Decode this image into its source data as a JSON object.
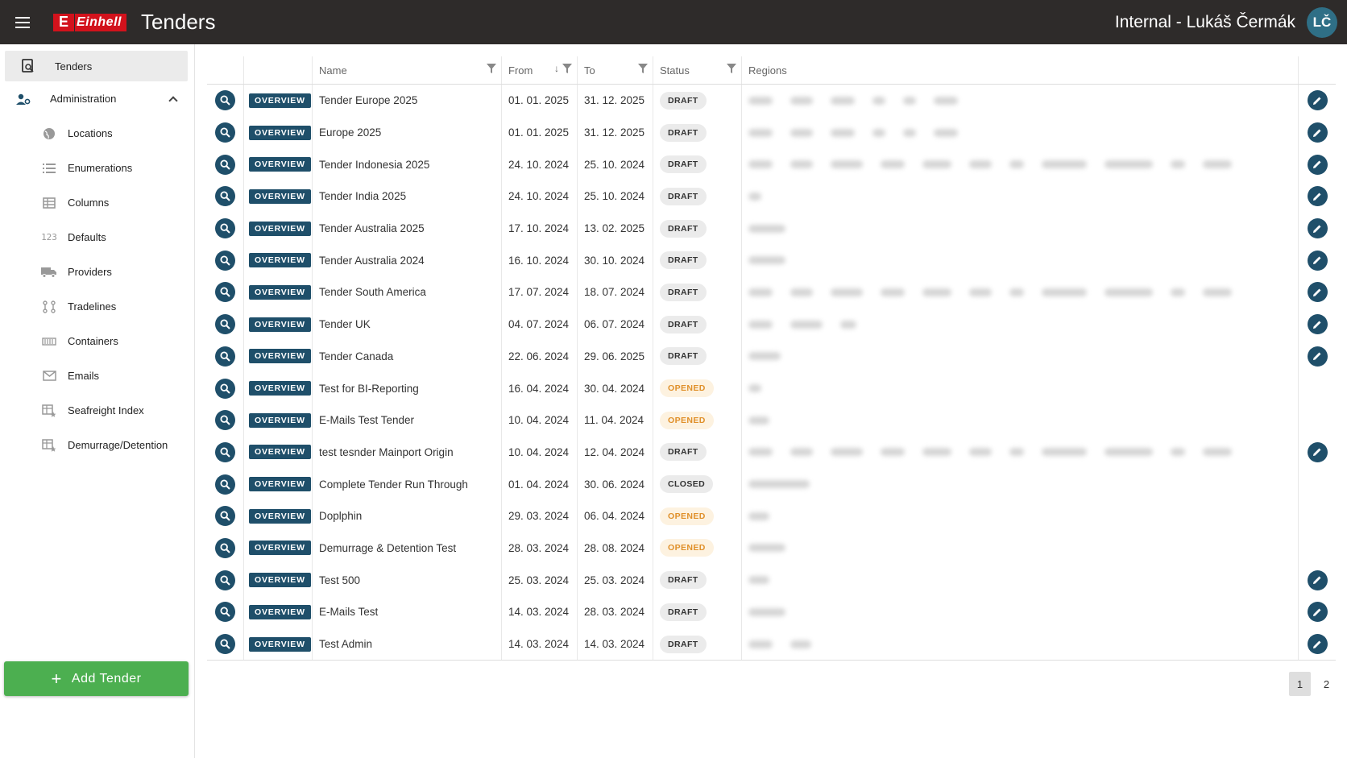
{
  "header": {
    "logo_letter": "E",
    "logo_text": "Einhell",
    "title": "Tenders",
    "user_name": "Internal - Lukáš Čermák",
    "avatar_initials": "LČ"
  },
  "sidebar": {
    "items": [
      {
        "label": "Tenders",
        "icon": "tenders-icon",
        "active": true
      },
      {
        "label": "Administration",
        "icon": "admin-users-icon",
        "expanded": true
      },
      {
        "label": "Locations",
        "icon": "globe-icon"
      },
      {
        "label": "Enumerations",
        "icon": "list-icon"
      },
      {
        "label": "Columns",
        "icon": "table-columns-icon"
      },
      {
        "label": "Defaults",
        "icon": "numbers-icon",
        "icon_text": "123"
      },
      {
        "label": "Providers",
        "icon": "truck-icon"
      },
      {
        "label": "Tradelines",
        "icon": "route-icon"
      },
      {
        "label": "Containers",
        "icon": "container-icon"
      },
      {
        "label": "Emails",
        "icon": "mail-icon"
      },
      {
        "label": "Seafreight Index",
        "icon": "table-star-icon"
      },
      {
        "label": "Demurrage/Detention",
        "icon": "table-star-icon"
      }
    ],
    "add_button": "Add Tender"
  },
  "table": {
    "columns": {
      "name": "Name",
      "from": "From",
      "to": "To",
      "status": "Status",
      "regions": "Regions"
    },
    "overview_label": "OVERVIEW",
    "rows": [
      {
        "name": "Tender Europe 2025",
        "from": "01. 01. 2025",
        "to": "31. 12. 2025",
        "status": "DRAFT",
        "editable": true
      },
      {
        "name": "Europe 2025",
        "from": "01. 01. 2025",
        "to": "31. 12. 2025",
        "status": "DRAFT",
        "editable": true
      },
      {
        "name": "Tender Indonesia 2025",
        "from": "24. 10. 2024",
        "to": "25. 10. 2024",
        "status": "DRAFT",
        "editable": true
      },
      {
        "name": "Tender India 2025",
        "from": "24. 10. 2024",
        "to": "25. 10. 2024",
        "status": "DRAFT",
        "editable": true
      },
      {
        "name": "Tender Australia 2025",
        "from": "17. 10. 2024",
        "to": "13. 02. 2025",
        "status": "DRAFT",
        "editable": true
      },
      {
        "name": "Tender Australia 2024",
        "from": "16. 10. 2024",
        "to": "30. 10. 2024",
        "status": "DRAFT",
        "editable": true
      },
      {
        "name": "Tender South America",
        "from": "17. 07. 2024",
        "to": "18. 07. 2024",
        "status": "DRAFT",
        "editable": true
      },
      {
        "name": "Tender UK",
        "from": "04. 07. 2024",
        "to": "06. 07. 2024",
        "status": "DRAFT",
        "editable": true
      },
      {
        "name": "Tender Canada",
        "from": "22. 06. 2024",
        "to": "29. 06. 2025",
        "status": "DRAFT",
        "editable": true
      },
      {
        "name": "Test for BI-Reporting",
        "from": "16. 04. 2024",
        "to": "30. 04. 2024",
        "status": "OPENED",
        "editable": false
      },
      {
        "name": "E-Mails Test Tender",
        "from": "10. 04. 2024",
        "to": "11. 04. 2024",
        "status": "OPENED",
        "editable": false
      },
      {
        "name": "test tesnder Mainport Origin",
        "from": "10. 04. 2024",
        "to": "12. 04. 2024",
        "status": "DRAFT",
        "editable": true
      },
      {
        "name": "Complete Tender Run Through",
        "from": "01. 04. 2024",
        "to": "30. 06. 2024",
        "status": "CLOSED",
        "editable": false
      },
      {
        "name": "Doplphin",
        "from": "29. 03. 2024",
        "to": "06. 04. 2024",
        "status": "OPENED",
        "editable": false
      },
      {
        "name": "Demurrage & Detention Test",
        "from": "28. 03. 2024",
        "to": "28. 08. 2024",
        "status": "OPENED",
        "editable": false
      },
      {
        "name": "Test 500",
        "from": "25. 03. 2024",
        "to": "25. 03. 2024",
        "status": "DRAFT",
        "editable": true
      },
      {
        "name": "E-Mails Test",
        "from": "14. 03. 2024",
        "to": "28. 03. 2024",
        "status": "DRAFT",
        "editable": true
      },
      {
        "name": "Test Admin",
        "from": "14. 03. 2024",
        "to": "14. 03. 2024",
        "status": "DRAFT",
        "editable": true
      }
    ]
  },
  "pagination": {
    "pages": [
      "1",
      "2"
    ],
    "current": "1"
  },
  "colors": {
    "header_bg": "#2e2b2a",
    "accent": "#1f4f6a",
    "add_button": "#4caf50",
    "brand_red": "#d2121c",
    "opened": "#e0902a"
  }
}
